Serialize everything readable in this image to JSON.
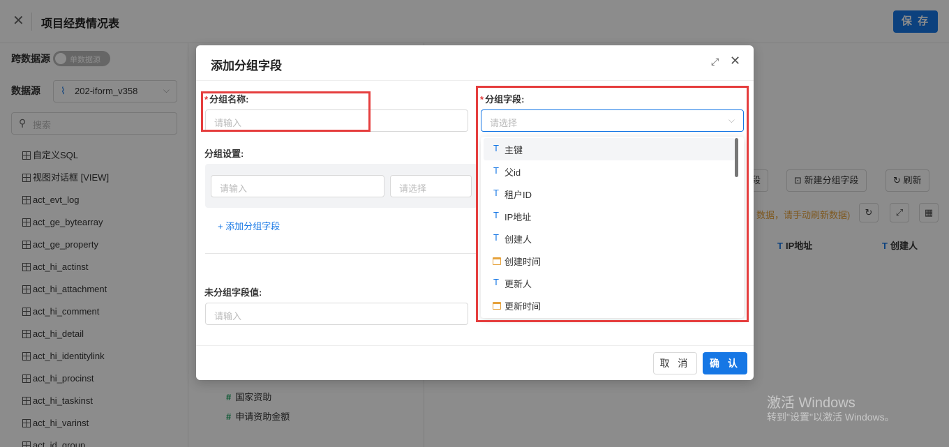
{
  "topbar": {
    "close_icon": "close-icon",
    "title": "项目经费情况表",
    "save_label": "保 存",
    "accent": "#1677e5"
  },
  "sidebar": {
    "cross_ds_label": "跨数据源",
    "toggle_label": "单数据源",
    "ds_label": "数据源",
    "ds_value": "202-iform_v358",
    "search_placeholder": "搜索",
    "tables": [
      "自定义SQL",
      "视图对话框 [VIEW]",
      "act_evt_log",
      "act_ge_bytearray",
      "act_ge_property",
      "act_hi_actinst",
      "act_hi_attachment",
      "act_hi_comment",
      "act_hi_detail",
      "act_hi_identitylink",
      "act_hi_procinst",
      "act_hi_taskinst",
      "act_hi_varinst",
      "act_id_group"
    ]
  },
  "mid": {
    "fields": [
      "国家资助",
      "申请资助金额"
    ]
  },
  "right": {
    "buttons": [
      "字段",
      "新建分组字段",
      "刷新"
    ],
    "warning": "数据，请手动刷新数据)",
    "columns": [
      "IP地址",
      "创建人"
    ],
    "watermark_line1": "激活 Windows",
    "watermark_line2": "转到\"设置\"以激活 Windows。"
  },
  "modal": {
    "title": "添加分组字段",
    "group_name_label": "分组名称:",
    "group_name_placeholder": "请输入",
    "group_field_label": "分组字段:",
    "group_field_placeholder": "请选择",
    "group_settings_label": "分组设置:",
    "settings_input_placeholder": "请输入",
    "settings_select_placeholder": "请选择",
    "add_group_field_link": "+ 添加分组字段",
    "ungrouped_label": "未分组字段值:",
    "ungrouped_placeholder": "请输入",
    "cancel_label": "取 消",
    "ok_label": "确 认",
    "options": [
      {
        "label": "主键",
        "type": "text"
      },
      {
        "label": "父id",
        "type": "text"
      },
      {
        "label": "租户ID",
        "type": "text"
      },
      {
        "label": "IP地址",
        "type": "text"
      },
      {
        "label": "创建人",
        "type": "text"
      },
      {
        "label": "创建时间",
        "type": "date"
      },
      {
        "label": "更新人",
        "type": "text"
      },
      {
        "label": "更新时间",
        "type": "date"
      }
    ],
    "highlight_color": "#e53e3e"
  }
}
